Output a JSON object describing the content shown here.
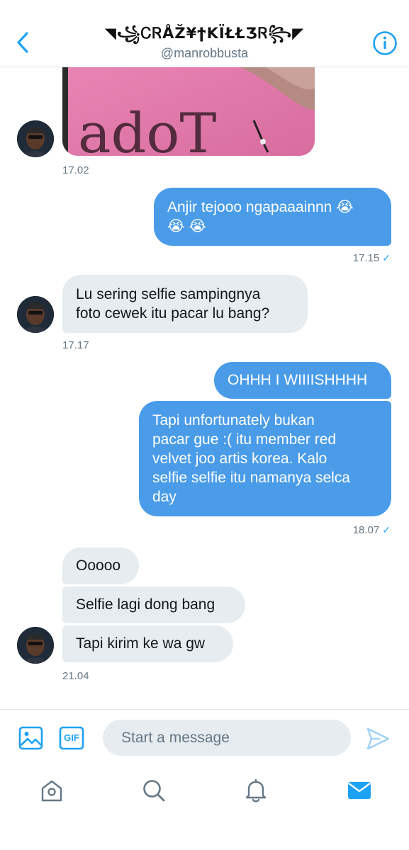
{
  "header": {
    "title": "◥꧁ᏟᏒÅŽ¥ϯKÏŁŁƷᏒ꧂◤",
    "handle": "@manrobbusta",
    "back_icon": "chevron-left-icon",
    "info_icon": "info-icon"
  },
  "messages": {
    "photo": {
      "description_icon": "image",
      "time": "17.02"
    },
    "m1": {
      "line1": "Anjir tejooo ngapaaainnn 😭",
      "line2": "😭 😭",
      "time": "17.15"
    },
    "m2": {
      "line1": "Lu sering selfie sampingnya",
      "line2": "foto cewek itu pacar lu bang?",
      "time": "17.17"
    },
    "m3": {
      "text": "OHHH I WIIIISHHHH"
    },
    "m4": {
      "lines": [
        "Tapi unfortunately bukan",
        "pacar gue :( itu member red",
        "velvet joo artis korea. Kalo",
        "selfie selfie itu namanya selca",
        "day"
      ],
      "time": "18.07"
    },
    "m5": {
      "text": "Ooooo"
    },
    "m6": {
      "text": "Selfie lagi dong bang"
    },
    "m7": {
      "text": "Tapi kirim ke wa gw",
      "time": "21.04"
    },
    "read_mark": "✓"
  },
  "composer": {
    "placeholder": "Start a message",
    "gif_label": "GIF"
  },
  "tabs": [
    "home",
    "search",
    "notifications",
    "messages"
  ],
  "colors": {
    "accent": "#1da1f2",
    "outgoing_bubble": "#4a9ce8",
    "incoming_bubble": "#e6ecf0",
    "muted_text": "#657786"
  }
}
